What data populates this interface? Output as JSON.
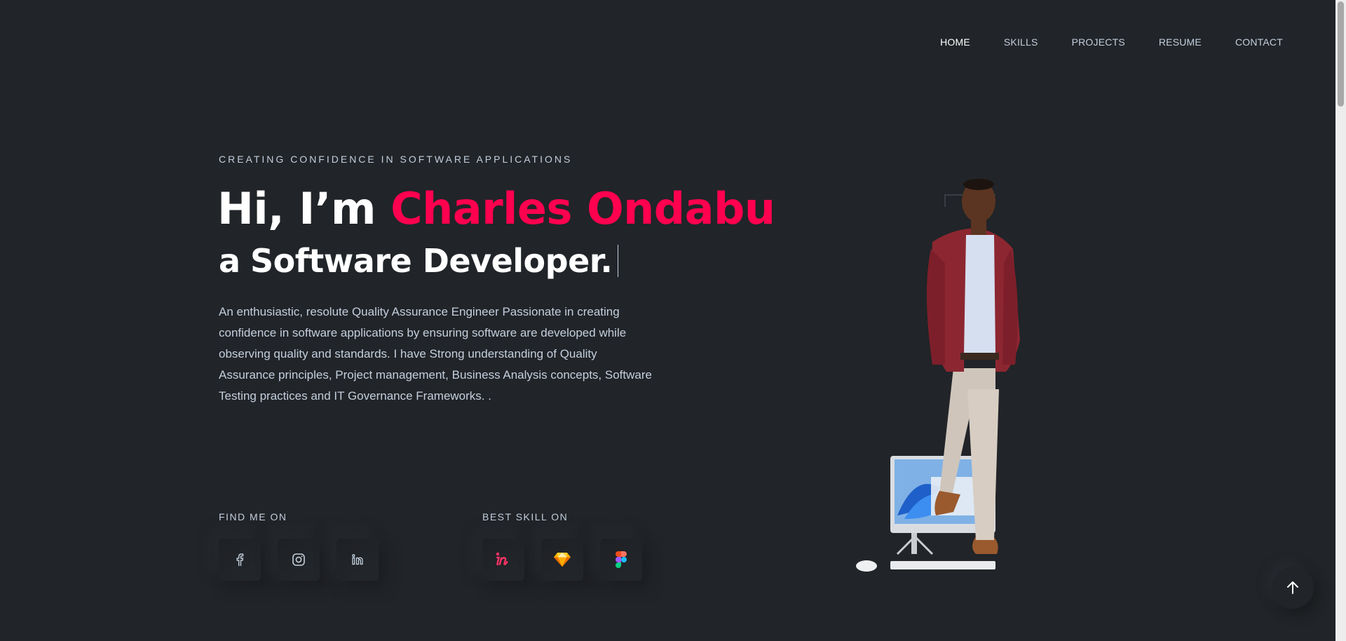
{
  "nav": {
    "items": [
      {
        "label": "HOME",
        "active": true
      },
      {
        "label": "SKILLS",
        "active": false
      },
      {
        "label": "PROJECTS",
        "active": false
      },
      {
        "label": "RESUME",
        "active": false
      },
      {
        "label": "CONTACT",
        "active": false
      }
    ]
  },
  "hero": {
    "subtitle": "CREATING CONFIDENCE IN SOFTWARE APPLICATIONS",
    "greeting": "Hi, I’m ",
    "name": "Charles Ondabu",
    "role_prefix": "a",
    "role": "Software Developer.",
    "description": "An enthusiastic, resolute Quality Assurance Engineer Passionate in creating confidence in software applications by ensuring software are developed while observing quality and standards. I have Strong understanding of Quality Assurance principles, Project management, Business Analysis concepts, Software Testing practices and IT Governance Frameworks. ."
  },
  "find_me": {
    "title": "FIND ME ON",
    "icons": [
      "facebook-icon",
      "instagram-icon",
      "linkedin-icon"
    ]
  },
  "best_skill": {
    "title": "BEST SKILL ON",
    "icons": [
      "invision-icon",
      "sketch-icon",
      "figma-icon"
    ]
  },
  "colors": {
    "background": "#212428",
    "accent": "#ff014f",
    "text": "#c4cfde",
    "heading": "#ffffff"
  },
  "back_to_top_icon": "arrow-up-icon"
}
